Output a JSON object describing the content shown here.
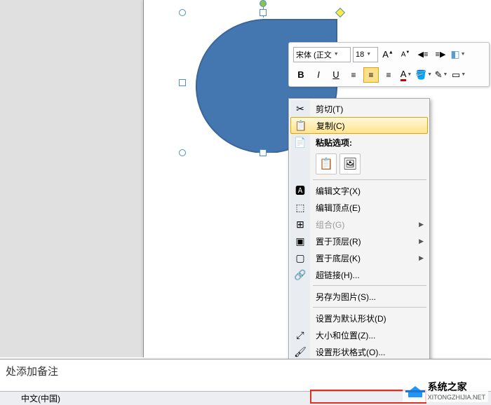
{
  "font": {
    "name": "宋体 (正文",
    "size": "18"
  },
  "toolbar": {
    "bold": "B",
    "italic": "I",
    "underline": "U"
  },
  "context_menu": {
    "cut": "剪切(T)",
    "copy": "复制(C)",
    "paste_options_label": "粘贴选项:",
    "edit_text": "编辑文字(X)",
    "edit_points": "编辑顶点(E)",
    "group": "组合(G)",
    "bring_front": "置于顶层(R)",
    "send_back": "置于底层(K)",
    "hyperlink": "超链接(H)...",
    "save_as_picture": "另存为图片(S)...",
    "set_default": "设置为默认形状(D)",
    "size_position": "大小和位置(Z)...",
    "format_shape": "设置形状格式(O)..."
  },
  "notes": {
    "placeholder": "处添加备注"
  },
  "status": {
    "language": "中文(中国)"
  },
  "watermark": {
    "title": "系统之家",
    "url": "XITONGZHIJIA.NET"
  }
}
